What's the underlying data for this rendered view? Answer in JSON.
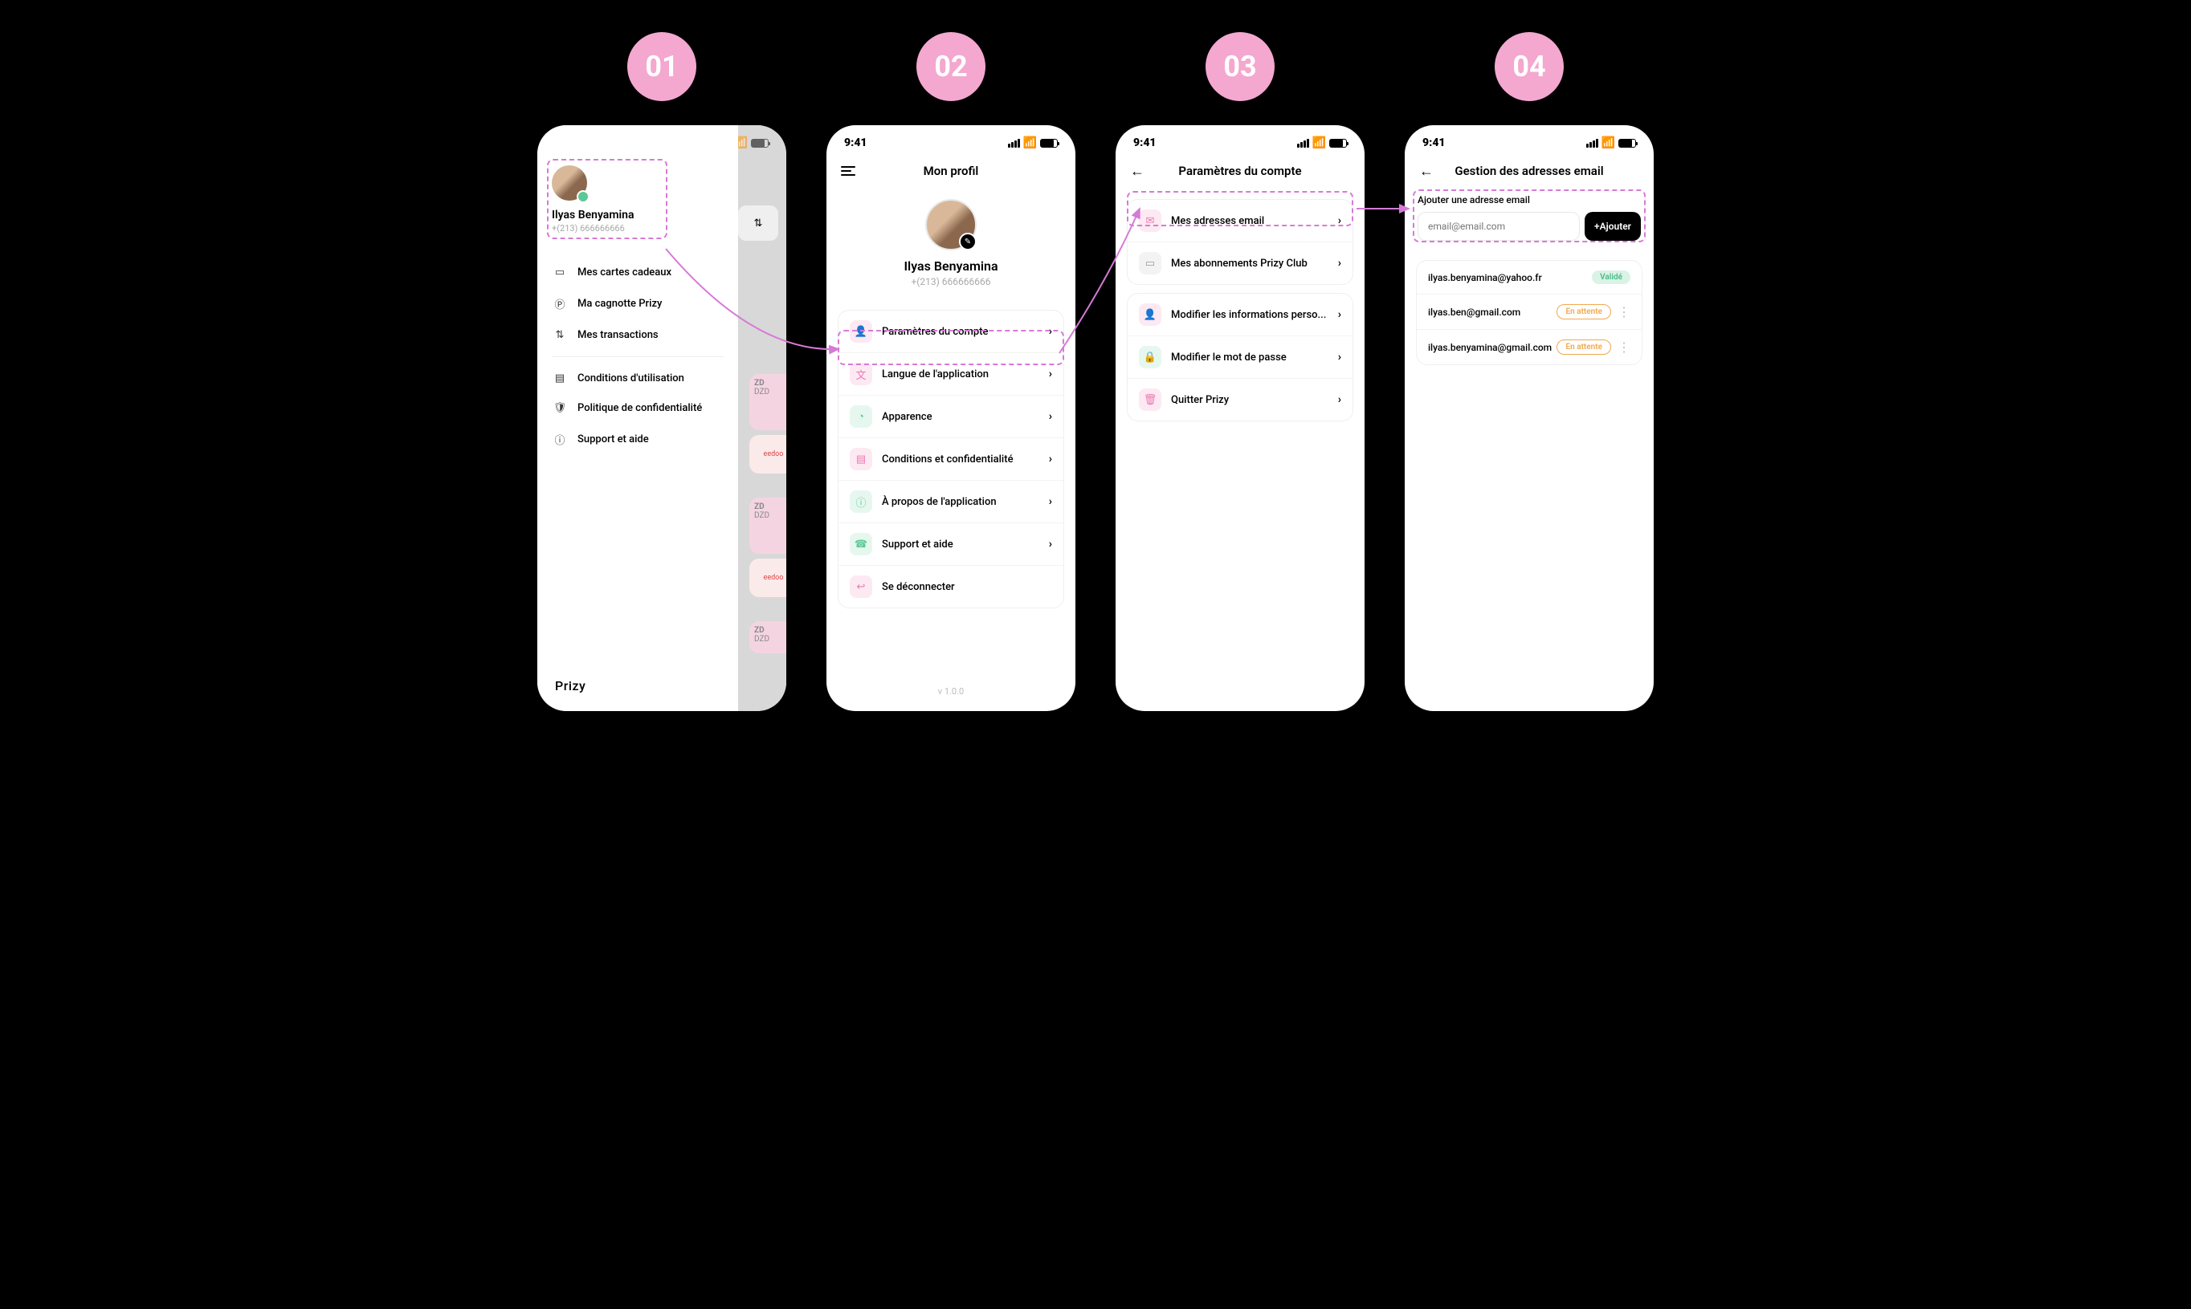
{
  "steps": [
    "01",
    "02",
    "03",
    "04"
  ],
  "statusTime": "9:41",
  "s1": {
    "user": "Ilyas Benyamina",
    "phone": "+(213) 666666666",
    "menu": [
      "Mes cartes cadeaux",
      "Ma cagnotte Prizy",
      "Mes transactions",
      "Conditions d'utilisation",
      "Politique de confidentialité",
      "Support et aide"
    ],
    "brand": "Prizy",
    "bgPrice": "ZD",
    "bgCurr": "DZD",
    "bgBrand": "eedoo"
  },
  "s2": {
    "title": "Mon profil",
    "user": "Ilyas Benyamina",
    "phone": "+(213) 666666666",
    "rows": [
      "Paramètres du compte",
      "Langue de l'application",
      "Apparence",
      "Conditions et confidentialité",
      "À propos de l'application",
      "Support et aide",
      "Se déconnecter"
    ],
    "version": "v 1.0.0"
  },
  "s3": {
    "title": "Paramètres du compte",
    "group1": [
      "Mes adresses email",
      "Mes abonnements Prizy Club"
    ],
    "group2": [
      "Modifier les informations perso...",
      "Modifier le mot de passe",
      "Quitter Prizy"
    ]
  },
  "s4": {
    "title": "Gestion des adresses email",
    "addLabel": "Ajouter une adresse email",
    "placeholder": "email@email.com",
    "addBtn": "+Ajouter",
    "emails": [
      {
        "addr": "ilyas.benyamina@yahoo.fr",
        "status": "Validé",
        "ok": true,
        "dots": false
      },
      {
        "addr": "ilyas.ben@gmail.com",
        "status": "En attente",
        "ok": false,
        "dots": true
      },
      {
        "addr": "ilyas.benyamina@gmail.com",
        "status": "En attente",
        "ok": false,
        "dots": true
      }
    ]
  }
}
